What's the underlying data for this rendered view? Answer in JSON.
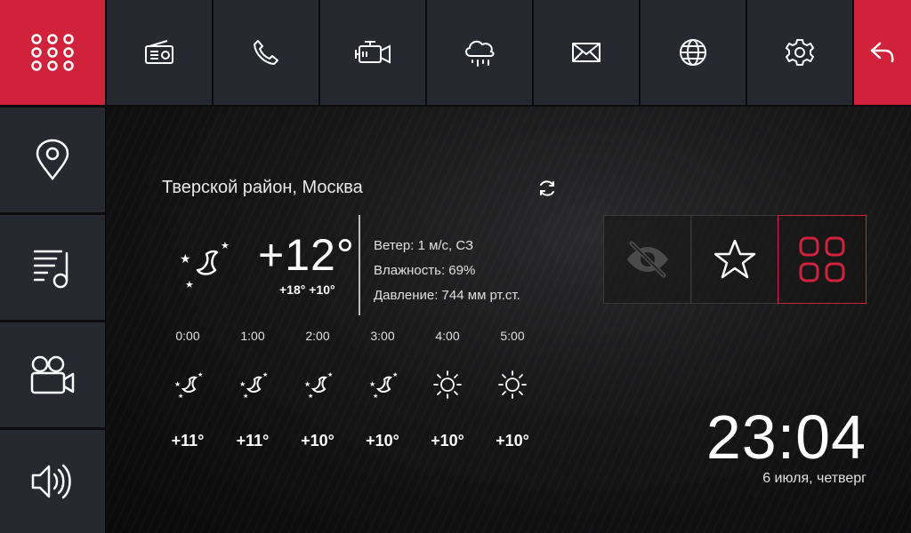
{
  "nav": {
    "top_icons": [
      "apps-grid-icon",
      "radio-icon",
      "phone-icon",
      "camera-vehicle-icon",
      "weather-cloud-icon",
      "mail-icon",
      "globe-icon",
      "gear-icon",
      "back-arrow-icon"
    ],
    "side_icons": [
      "location-pin-icon",
      "music-playlist-icon",
      "video-camera-icon",
      "speaker-icon"
    ]
  },
  "weather": {
    "location": "Тверской район, Москва",
    "current_temp": "+12°",
    "temp_range": "+18° +10°",
    "wind": "Ветер: 1 м/с,  СЗ",
    "humidity": "Влажность: 69%",
    "pressure": "Давление: 744 мм рт.ст.",
    "hourly": [
      {
        "time": "0:00",
        "icon": "night-moon-icon",
        "temp": "+11°"
      },
      {
        "time": "1:00",
        "icon": "night-moon-icon",
        "temp": "+11°"
      },
      {
        "time": "2:00",
        "icon": "night-moon-icon",
        "temp": "+10°"
      },
      {
        "time": "3:00",
        "icon": "night-moon-icon",
        "temp": "+10°"
      },
      {
        "time": "4:00",
        "icon": "sun-icon",
        "temp": "+10°"
      },
      {
        "time": "5:00",
        "icon": "sun-icon",
        "temp": "+10°"
      }
    ]
  },
  "actions": [
    "hide-eye-icon",
    "favorite-star-icon",
    "widgets-grid-icon"
  ],
  "clock": {
    "time": "23:04",
    "date": "6 июля, четверг"
  },
  "colors": {
    "accent": "#d0233b",
    "tile": "#262a30"
  }
}
